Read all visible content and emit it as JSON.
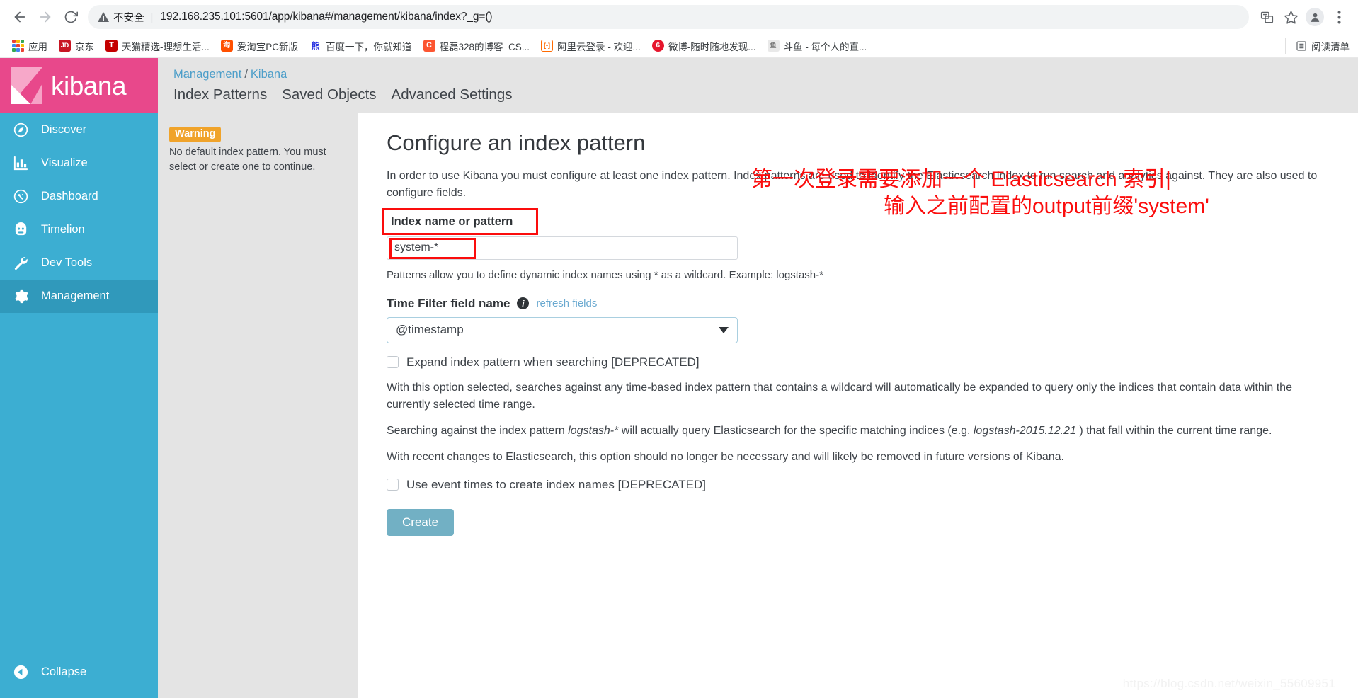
{
  "browser": {
    "back_icon": "back-arrow-icon",
    "forward_icon": "forward-arrow-icon",
    "reload_icon": "reload-icon",
    "security_label": "不安全",
    "url_host": "192.168.235.101",
    "url_port": ":5601",
    "url_path": "/app/kibana#/management/kibana/index?_g=()",
    "url_full": "192.168.235.101:5601/app/kibana#/management/kibana/index?_g=()",
    "translate_icon": "translate-icon",
    "bookmark_star_icon": "star-icon",
    "profile_icon": "profile-avatar-icon",
    "menu_icon": "three-dot-menu-icon",
    "bookmarks": [
      {
        "label": "应用",
        "icon": "apps-grid-icon",
        "badge": "",
        "color": ""
      },
      {
        "label": "京东",
        "icon": "jd-icon",
        "badge": "JD",
        "color": "#c81623"
      },
      {
        "label": "天猫精选-理想生活...",
        "icon": "tmall-icon",
        "badge": "T",
        "color": "#c40000"
      },
      {
        "label": "爱淘宝PC新版",
        "icon": "taobao-icon",
        "badge": "淘",
        "color": "#ff5000"
      },
      {
        "label": "百度一下，你就知道",
        "icon": "baidu-icon",
        "badge": "百",
        "color": "#2932e1"
      },
      {
        "label": "程磊328的博客_CS...",
        "icon": "csdn-icon",
        "badge": "C",
        "color": "#fc5531"
      },
      {
        "label": "阿里云登录 - 欢迎...",
        "icon": "aliyun-icon",
        "badge": "[-]",
        "color": "#ff6a00"
      },
      {
        "label": "微博-随时随地发现...",
        "icon": "weibo-icon",
        "badge": "6",
        "color": "#e6162d"
      },
      {
        "label": "斗鱼 - 每个人的直...",
        "icon": "douyu-icon",
        "badge": "鱼",
        "color": "#ff7700"
      }
    ],
    "reading_list_label": "阅读清单",
    "reading_list_icon": "reading-list-icon"
  },
  "sidebar": {
    "logo_text": "kibana",
    "items": [
      {
        "label": "Discover",
        "icon": "compass-icon",
        "active": false
      },
      {
        "label": "Visualize",
        "icon": "bar-chart-icon",
        "active": false
      },
      {
        "label": "Dashboard",
        "icon": "dashboard-icon",
        "active": false
      },
      {
        "label": "Timelion",
        "icon": "timelion-icon",
        "active": false
      },
      {
        "label": "Dev Tools",
        "icon": "wrench-icon",
        "active": false
      },
      {
        "label": "Management",
        "icon": "gear-icon",
        "active": true
      }
    ],
    "collapse_label": "Collapse",
    "collapse_icon": "collapse-left-icon",
    "bg_color": "#3caed2",
    "logo_bg_color": "#e8488b",
    "active_bg_color": "#3099bb"
  },
  "header": {
    "breadcrumb": {
      "root": "Management",
      "separator": "/",
      "current": "Kibana"
    },
    "tabs": [
      {
        "label": "Index Patterns",
        "active": true
      },
      {
        "label": "Saved Objects",
        "active": false
      },
      {
        "label": "Advanced Settings",
        "active": false
      }
    ]
  },
  "warning_panel": {
    "badge": "Warning",
    "badge_color": "#f0a32a",
    "message": "No default index pattern. You must select or create one to continue."
  },
  "main": {
    "title": "Configure an index pattern",
    "intro": "In order to use Kibana you must configure at least one index pattern. Index patterns are used to identify the Elasticsearch index to run search and analytics against. They are also used to configure fields.",
    "index_label": "Index name or pattern",
    "index_value": "system-*",
    "index_placeholder": "",
    "pattern_hint": "Patterns allow you to define dynamic index names using * as a wildcard. Example: logstash-*",
    "time_filter_label": "Time Filter field name",
    "info_icon": "info-icon",
    "refresh_fields_link": "refresh fields",
    "time_filter_value": "@timestamp",
    "time_filter_options": [
      "@timestamp"
    ],
    "checkbox_expand": {
      "label": "Expand index pattern when searching [DEPRECATED]",
      "checked": false
    },
    "expand_paragraph_1": "With this option selected, searches against any time-based index pattern that contains a wildcard will automatically be expanded to query only the indices that contain data within the currently selected time range.",
    "expand_paragraph_2_a": "Searching against the index pattern ",
    "expand_paragraph_2_em1": "logstash-*",
    "expand_paragraph_2_b": " will actually query Elasticsearch for the specific matching indices (e.g. ",
    "expand_paragraph_2_em2": "logstash-2015.12.21",
    "expand_paragraph_2_c": " ) that fall within the current time range.",
    "expand_paragraph_3": "With recent changes to Elasticsearch, this option should no longer be necessary and will likely be removed in future versions of Kibana.",
    "checkbox_event_times": {
      "label": "Use event times to create index names [DEPRECATED]",
      "checked": false
    },
    "create_button": "Create",
    "create_button_color": "#72b0c4"
  },
  "annotations": {
    "color": "#fb0d0d",
    "line1": "第一次登录需要添加一个 Elasticsearch 索引|",
    "line2": "输入之前配置的output前缀'system'"
  },
  "watermark": "https://blog.csdn.net/weixin_55609951"
}
